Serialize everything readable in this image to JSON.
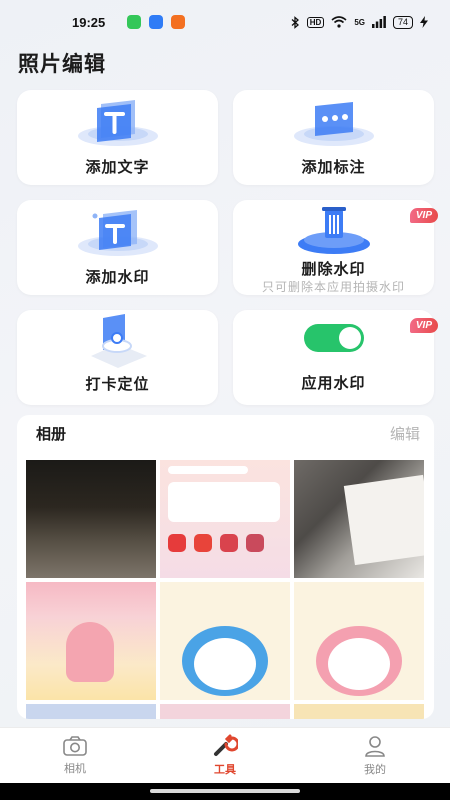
{
  "status": {
    "time": "19:25",
    "battery": "74",
    "network": "5G",
    "hd": "HD"
  },
  "page": {
    "title": "照片编辑"
  },
  "tools": {
    "add_text": "添加文字",
    "add_annotation": "添加标注",
    "add_watermark": "添加水印",
    "remove_watermark": "删除水印",
    "remove_watermark_note": "只可删除本应用拍摄水印",
    "checkin_location": "打卡定位",
    "apply_watermark": "应用水印",
    "vip_badge": "VIP"
  },
  "album": {
    "title": "相册",
    "edit": "编辑"
  },
  "nav": {
    "camera": "相机",
    "tools": "工具",
    "mine": "我的"
  },
  "colors": {
    "accent": "#e0472f",
    "toggle": "#27c46b",
    "vip": "#e84a4a",
    "illus": "#3d7cf5"
  },
  "icons": [
    "camera-icon",
    "wrench-icon",
    "person-icon",
    "trash-icon"
  ]
}
